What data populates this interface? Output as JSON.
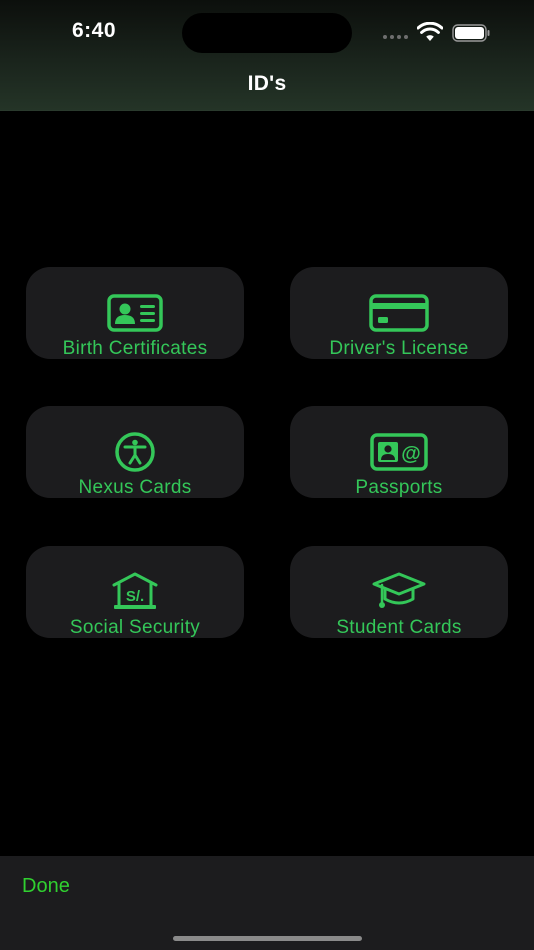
{
  "status_bar": {
    "time": "6:40"
  },
  "nav": {
    "title": "ID's"
  },
  "tiles": [
    {
      "label": "Birth Certificates",
      "icon": "person-card-icon"
    },
    {
      "label": "Driver's License",
      "icon": "credit-card-icon"
    },
    {
      "label": "Nexus Cards",
      "icon": "accessibility-icon"
    },
    {
      "label": "Passports",
      "icon": "contact-card-at-icon"
    },
    {
      "label": "Social Security",
      "icon": "building-currency-icon"
    },
    {
      "label": "Student Cards",
      "icon": "graduation-cap-icon"
    }
  ],
  "toolbar": {
    "done_label": "Done"
  },
  "colors": {
    "accent": "#34c759",
    "done": "#30d030",
    "tile_background": "#1c1c1e"
  }
}
